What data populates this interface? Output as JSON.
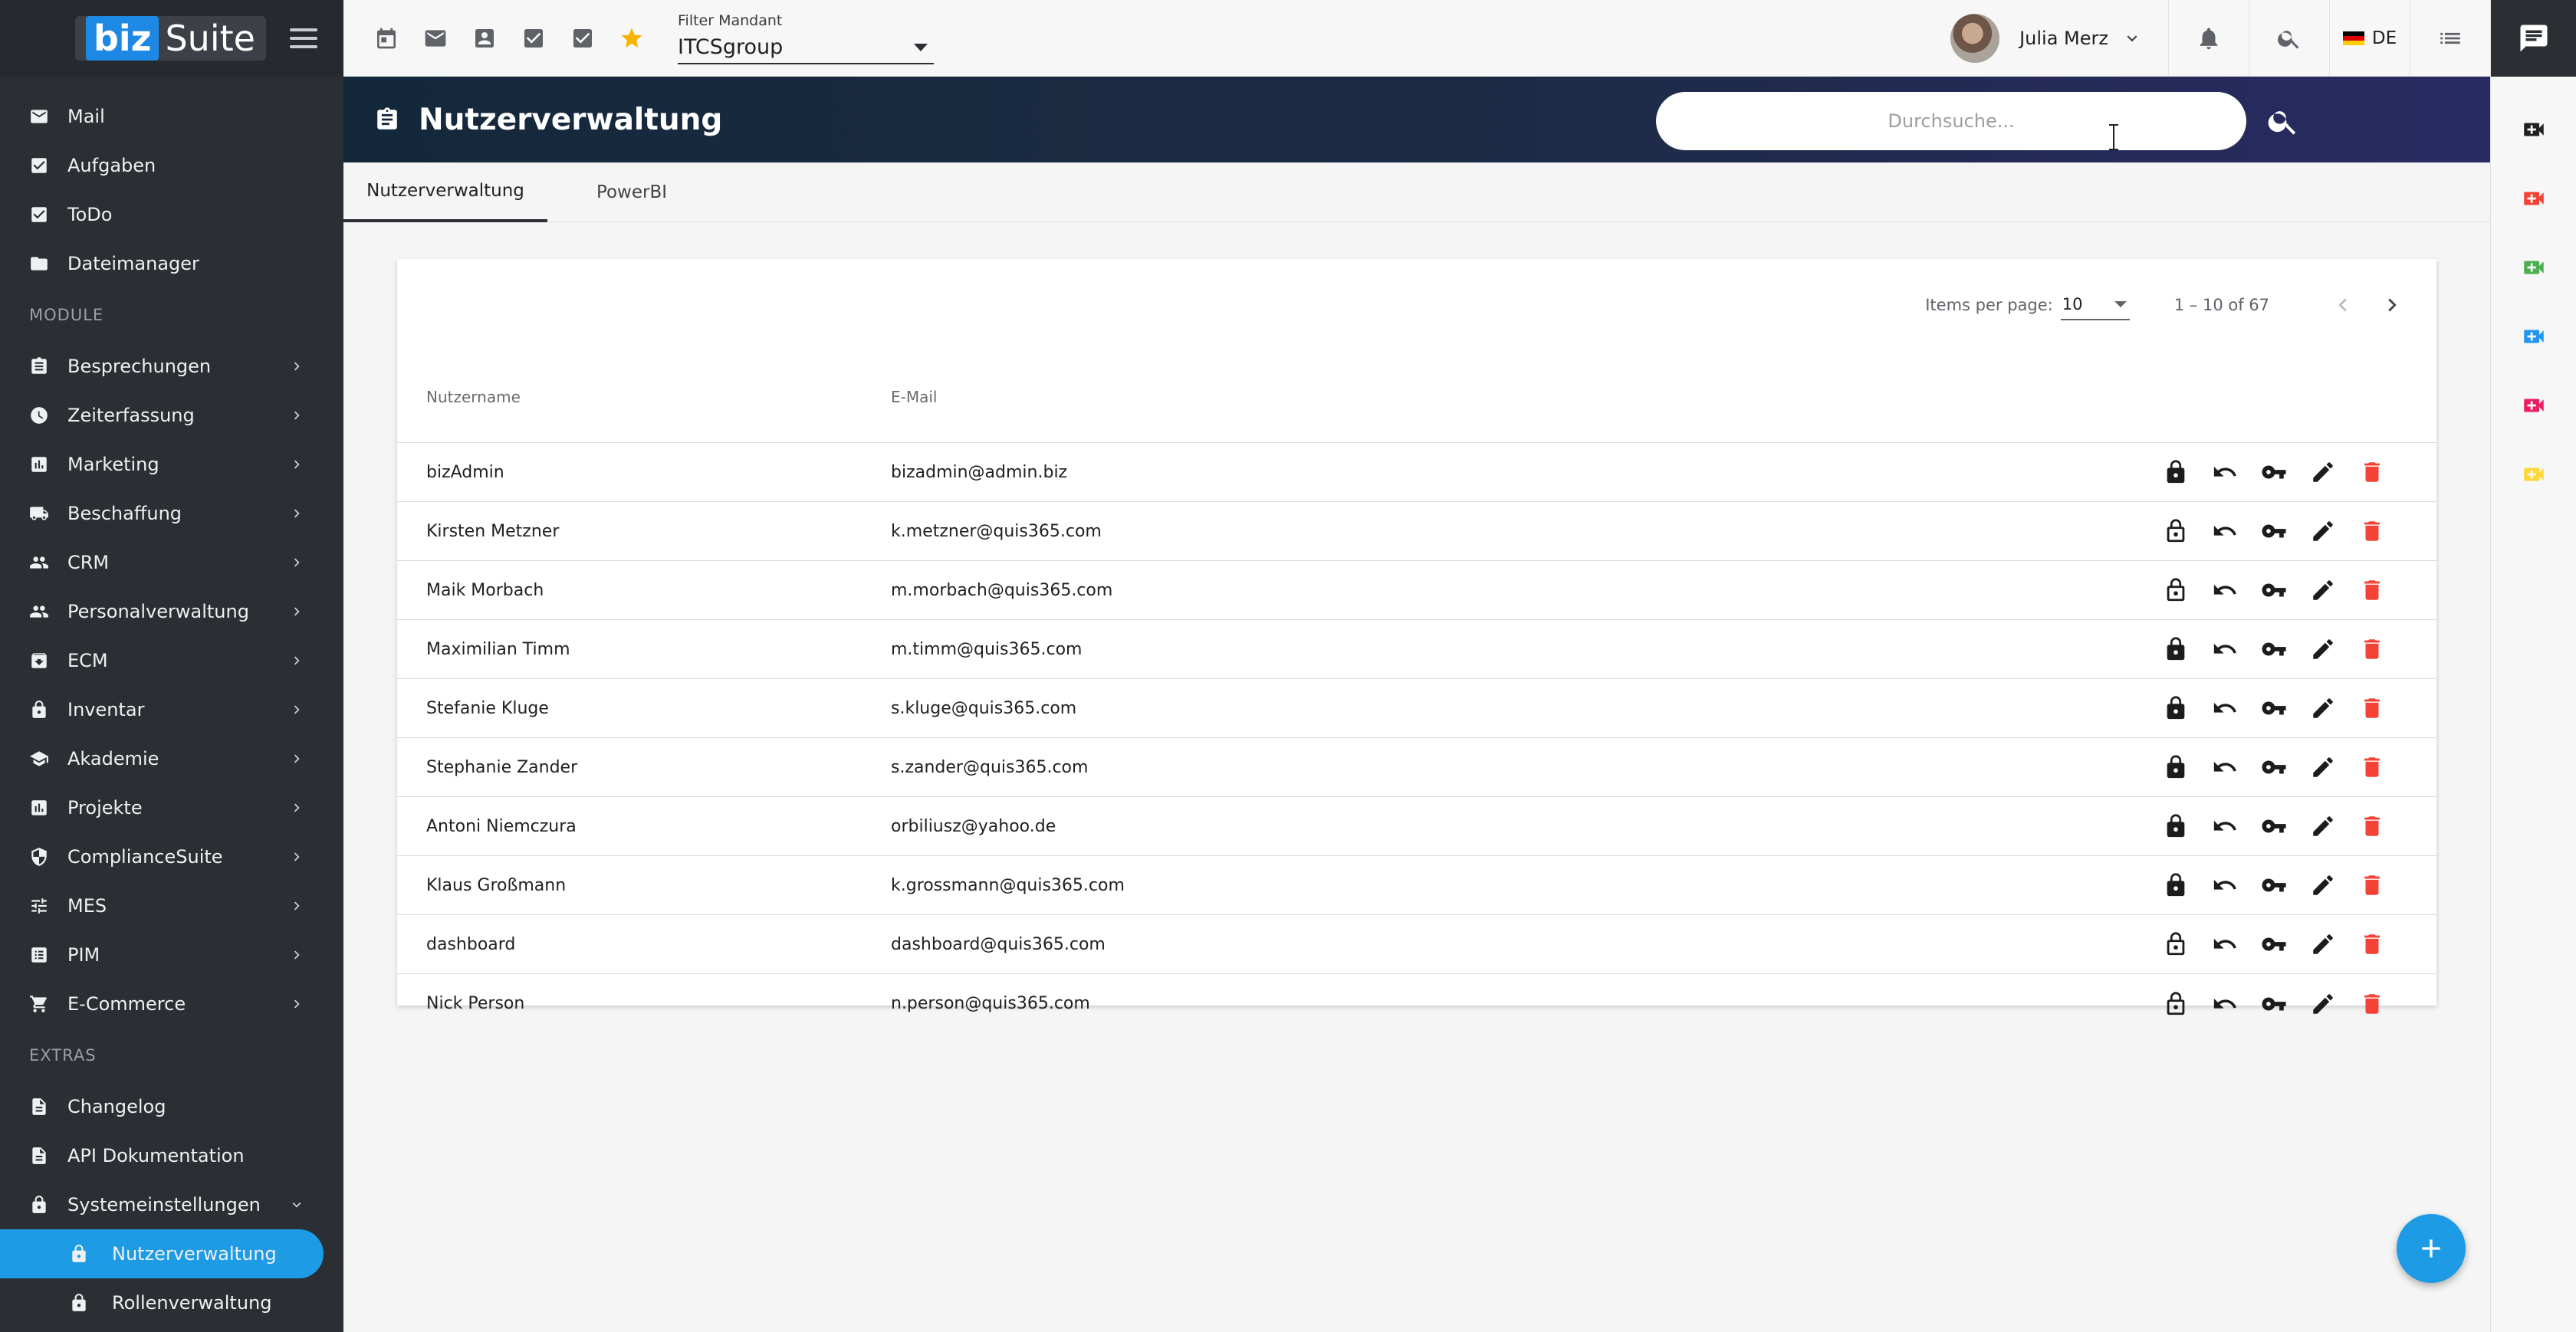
{
  "brand": {
    "biz": "biz",
    "suite": "Suite"
  },
  "sidebar": {
    "main": [
      {
        "label": "Mail",
        "icon": "mail-icon"
      },
      {
        "label": "Aufgaben",
        "icon": "checkbox-icon"
      },
      {
        "label": "ToDo",
        "icon": "checkbox-icon"
      },
      {
        "label": "Dateimanager",
        "icon": "folder-icon"
      }
    ],
    "module_title": "MODULE",
    "modules": [
      {
        "label": "Besprechungen",
        "icon": "clipboard-icon"
      },
      {
        "label": "Zeiterfassung",
        "icon": "clock-icon"
      },
      {
        "label": "Marketing",
        "icon": "chart-icon"
      },
      {
        "label": "Beschaffung",
        "icon": "truck-icon"
      },
      {
        "label": "CRM",
        "icon": "people-icon"
      },
      {
        "label": "Personalverwaltung",
        "icon": "people-icon"
      },
      {
        "label": "ECM",
        "icon": "archive-icon"
      },
      {
        "label": "Inventar",
        "icon": "lock-icon"
      },
      {
        "label": "Akademie",
        "icon": "school-icon"
      },
      {
        "label": "Projekte",
        "icon": "chart-icon"
      },
      {
        "label": "ComplianceSuite",
        "icon": "shield-icon"
      },
      {
        "label": "MES",
        "icon": "tune-icon"
      },
      {
        "label": "PIM",
        "icon": "list-icon"
      },
      {
        "label": "E-Commerce",
        "icon": "cart-icon"
      }
    ],
    "extras_title": "EXTRAS",
    "extras": [
      {
        "label": "Changelog",
        "icon": "document-icon"
      },
      {
        "label": "API Dokumentation",
        "icon": "document-icon"
      },
      {
        "label": "Systemeinstellungen",
        "icon": "lock-icon"
      }
    ],
    "sub": [
      {
        "label": "Nutzerverwaltung",
        "icon": "lock-icon"
      },
      {
        "label": "Rollenverwaltung",
        "icon": "lock-icon"
      }
    ]
  },
  "topbar": {
    "filter_label": "Filter Mandant",
    "filter_value": "ITCSgroup",
    "user_name": "Julia Merz",
    "language": "DE"
  },
  "header": {
    "title": "Nutzerverwaltung",
    "search_placeholder": "Durchsuche..."
  },
  "tabs": [
    {
      "label": "Nutzerverwaltung"
    },
    {
      "label": "PowerBI"
    }
  ],
  "paginator": {
    "items_per_page_label": "Items per page:",
    "items_per_page": "10",
    "range": "1 – 10 of 67"
  },
  "table": {
    "columns": [
      "Nutzername",
      "E-Mail"
    ],
    "rows": [
      {
        "name": "bizAdmin",
        "email": "bizadmin@admin.biz",
        "locked": true
      },
      {
        "name": "Kirsten Metzner",
        "email": "k.metzner@quis365.com",
        "locked": false
      },
      {
        "name": "Maik Morbach",
        "email": "m.morbach@quis365.com",
        "locked": false
      },
      {
        "name": "Maximilian Timm",
        "email": "m.timm@quis365.com",
        "locked": true
      },
      {
        "name": "Stefanie Kluge",
        "email": "s.kluge@quis365.com",
        "locked": true
      },
      {
        "name": "Stephanie Zander",
        "email": "s.zander@quis365.com",
        "locked": true
      },
      {
        "name": "Antoni Niemczura",
        "email": "orbiliusz@yahoo.de",
        "locked": true
      },
      {
        "name": "Klaus Großmann",
        "email": "k.grossmann@quis365.com",
        "locked": true
      },
      {
        "name": "dashboard",
        "email": "dashboard@quis365.com",
        "locked": false
      },
      {
        "name": "Nick Person",
        "email": "n.person@quis365.com",
        "locked": false
      }
    ]
  },
  "colors": {
    "accent": "#1e9be5",
    "sidebar_bg": "#2b2e33",
    "delete": "#f44336",
    "star": "#f5b400",
    "rail_video": [
      "#212121",
      "#f44336",
      "#4caf50",
      "#2196f3",
      "#e91e63",
      "#fdd835"
    ]
  }
}
